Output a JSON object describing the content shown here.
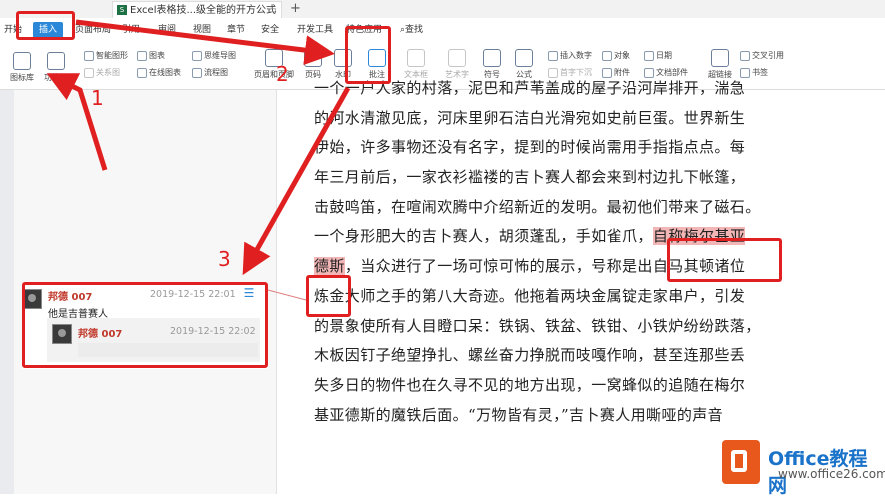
{
  "tabbar": {
    "doc_tab_title": "Excel表格技...级全能的开方公式",
    "add_tab": "+"
  },
  "menu": {
    "items": [
      "开始",
      "插入",
      "页面布局",
      "引用",
      "审阅",
      "视图",
      "章节",
      "安全",
      "开发工具",
      "特色应用",
      "查找"
    ]
  },
  "ribbon": {
    "group1": [
      "图标库",
      "功能图"
    ],
    "smart_shape": "智能图形",
    "chart": "图表",
    "mind_map": "思维导图",
    "relation_map": "关系图",
    "online_chart": "在线图表",
    "flowchart": "流程图",
    "header_footer": "页眉和页脚",
    "page_number": "页码",
    "watermark": "水印",
    "comment": "批注",
    "text_box": "文本框",
    "art_text": "艺术字",
    "symbol": "符号",
    "formula": "公式",
    "insert_number": "插入数字",
    "drop_cap": "首字下沉",
    "object": "对象",
    "attachment": "附件",
    "date": "日期",
    "doc_parts": "文档部件",
    "hyperlink": "超链接",
    "cross_ref": "交叉引用",
    "bookmark": "书签"
  },
  "document": {
    "lines": [
      "一个一户人家的村落，泥巴和芦苇盖成的屋子沿河岸排开，湍急",
      "的河水清澈见底，河床里卵石洁白光滑宛如史前巨蛋。世界新生",
      "伊始，许多事物还没有名字，提到的时候尚需用手指指点点。每",
      "年三月前后，一家衣衫褴褛的吉卜赛人都会来到村边扎下帐篷，",
      "击鼓鸣笛，在喧闹欢腾中介绍新近的发明。最初他们带来了磁石。",
      "一个身形肥大的吉卜赛人，胡须蓬乱，手如雀爪，",
      "德斯，当众进行了一场可惊可怖的展示，号称是出自马其顿诸位",
      "炼金大师之手的第八大奇迹。他拖着两块金属锭走家串户，引发",
      "的景象使所有人目瞪口呆：铁锅、铁盆、铁钳、小铁炉纷纷跌落，",
      "木板因钉子绝望挣扎、螺丝奋力挣脱而吱嘎作响，甚至连那些丢",
      "失多日的物件也在久寻不见的地方出现，一窝蜂似的追随在梅尔",
      "基亚德斯的魔铁后面。“万物皆有灵，”吉卜赛人用嘶哑的声音"
    ],
    "highlight_line6_tail": "自称梅尔基亚",
    "highlight_line7_head": "德斯"
  },
  "comment": {
    "author": "邦德 007",
    "timestamp": "2019-12-15 22:01",
    "text": "他是吉普赛人",
    "reply_author": "邦德 007",
    "reply_timestamp": "2019-12-15 22:02"
  },
  "annotations": {
    "label1": "1",
    "label2": "2",
    "label3": "3"
  },
  "watermark": {
    "title": "Office教程网",
    "url": "www.office26.com"
  },
  "colors": {
    "accent": "#2b88d8",
    "annotation_red": "#e02020",
    "highlight": "#f2b6b6",
    "author_red": "#c0392b"
  }
}
